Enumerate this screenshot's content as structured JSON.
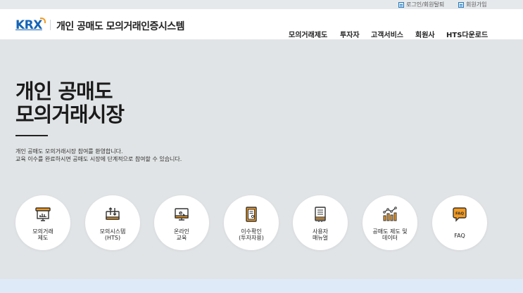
{
  "util": {
    "login": "로그인/회원탈퇴",
    "join": "회원가입"
  },
  "header": {
    "logo": "KRX",
    "site_title": "개인 공매도 모의거래인증시스템",
    "nav": [
      "모의거래제도",
      "투자자",
      "고객서비스",
      "회원사",
      "HTS다운로드"
    ]
  },
  "hero": {
    "title_line1": "개인 공매도",
    "title_line2": "모의거래시장",
    "desc_line1": "개인 공매도 모의거래시장 참여를 환영합니다.",
    "desc_line2": "교육 이수를 완료하시면 공매도 시장에 단계적으로 참여할 수 있습니다."
  },
  "menu": [
    {
      "line1": "모의거래",
      "line2": "제도",
      "icon": "presentation-chart-icon"
    },
    {
      "line1": "모의시스템",
      "line2": "(HTS)",
      "icon": "trading-system-icon"
    },
    {
      "line1": "온라인",
      "line2": "교육",
      "icon": "online-education-icon"
    },
    {
      "line1": "이수확인",
      "line2": "(투자자용)",
      "icon": "certificate-icon"
    },
    {
      "line1": "사용자",
      "line2": "매뉴얼",
      "icon": "manual-book-icon"
    },
    {
      "line1": "공매도 제도 및",
      "line2": "데이터",
      "icon": "data-chart-icon"
    },
    {
      "line1": "FAQ",
      "line2": "",
      "icon": "faq-bubble-icon"
    }
  ],
  "colors": {
    "accent_orange": "#f39a1f",
    "brand_blue": "#1564b5",
    "hero_bg": "#e1e4e6"
  }
}
